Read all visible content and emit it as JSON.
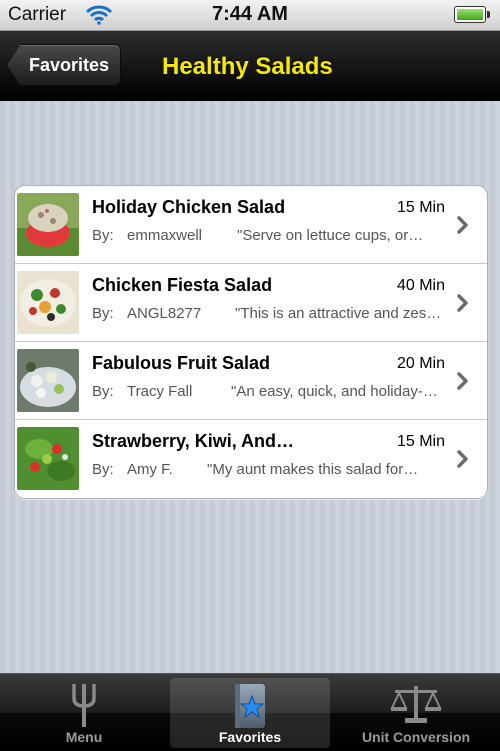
{
  "status_bar": {
    "carrier": "Carrier",
    "time": "7:44 AM"
  },
  "nav": {
    "back_label": "Favorites",
    "title": "Healthy Salads"
  },
  "recipes": [
    {
      "title": "Holiday Chicken Salad",
      "time": "15 Min",
      "by_label": "By:",
      "author": "emmaxwell",
      "description": "\"Serve on lettuce cups, or…"
    },
    {
      "title": "Chicken Fiesta Salad",
      "time": "40 Min",
      "by_label": "By:",
      "author": "ANGL8277",
      "description": "\"This is an attractive and zes…"
    },
    {
      "title": "Fabulous Fruit Salad",
      "time": "20 Min",
      "by_label": "By:",
      "author": "Tracy Fall",
      "description": "\"An easy, quick, and holiday-…"
    },
    {
      "title": "Strawberry, Kiwi, And…",
      "time": "15 Min",
      "by_label": "By:",
      "author": "Amy F.",
      "description": "\"My aunt makes this salad for…"
    }
  ],
  "tabs": [
    {
      "label": "Menu",
      "icon": "fork-icon"
    },
    {
      "label": "Favorites",
      "icon": "star-icon",
      "selected": true
    },
    {
      "label": "Unit Conversion",
      "icon": "scale-icon"
    }
  ],
  "colors": {
    "nav_title": "#f5e90a",
    "tab_selected": "#ffffff",
    "tab_normal": "#9a9a9a"
  }
}
